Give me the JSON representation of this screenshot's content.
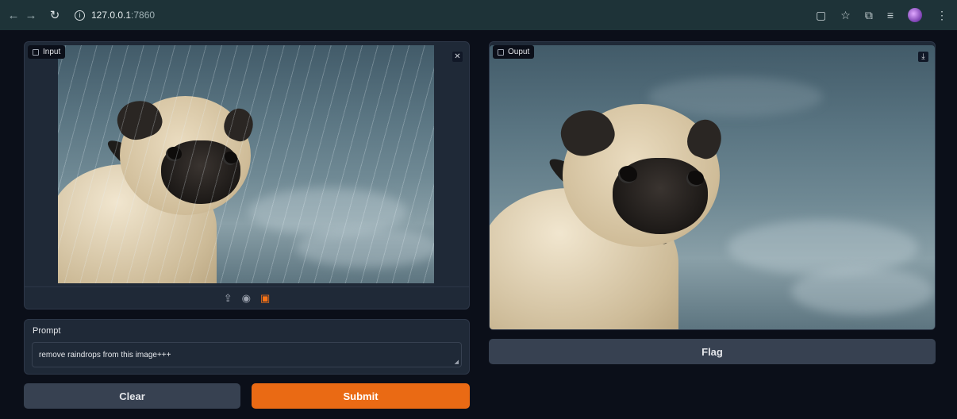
{
  "browser": {
    "back_icon": "arrow-left-icon",
    "forward_icon": "arrow-right-icon",
    "reload_icon": "reload-icon",
    "url_host": "127.0.0.1",
    "url_port": ":7860"
  },
  "input": {
    "label": "Input",
    "clear_icon": "close-icon",
    "sources": [
      "upload-icon",
      "webcam-icon",
      "clipboard-icon"
    ]
  },
  "output": {
    "label": "Ouput",
    "download_icon": "download-icon"
  },
  "prompt": {
    "label": "Prompt",
    "value": "remove raindrops from this image+++"
  },
  "buttons": {
    "clear": "Clear",
    "submit": "Submit",
    "flag": "Flag"
  },
  "colors": {
    "page_bg": "#0b0f19",
    "panel_bg": "#1f2937",
    "primary": "#ea6a14",
    "secondary": "#374151"
  }
}
